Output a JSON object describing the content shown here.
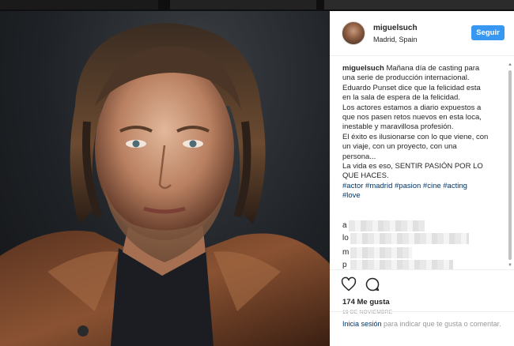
{
  "post": {
    "username": "miguelsuch",
    "location": "Madrid, Spain",
    "follow_label": "Seguir",
    "caption_lines": [
      "Mañana día de casting para",
      "una serie de producción internacional.",
      "Eduardo Punset dice que la felicidad esta",
      "en la sala de espera de la felicidad.",
      "Los actores estamos a diario expuestos a",
      "que nos pasen retos nuevos en esta loca,",
      "inestable y maravillosa profesión.",
      "El éxito es ilusionarse con lo que viene, con",
      "un viaje, con un proyecto, con una",
      "persona...",
      "La vida es eso, SENTIR PASIÓN POR LO",
      "QUE HACES."
    ],
    "hashtags_line1": "#actor #madrid #pasion #cine #acting",
    "hashtags_line2": "#love",
    "blurred_comment_initials": [
      "a",
      "lo",
      "m",
      "p"
    ],
    "likes": "174 Me gusta",
    "date": "19 DE NOVIEMBRE",
    "login_link": "Inicia sesión",
    "login_rest": " para indicar que te gusta o comentar."
  },
  "icons": {
    "like": "heart-icon",
    "comment": "comment-bubble-icon",
    "avatar": "profile-avatar"
  },
  "colors": {
    "follow_button": "#3897f0",
    "hashtag": "#003569",
    "muted_text": "#999999"
  }
}
